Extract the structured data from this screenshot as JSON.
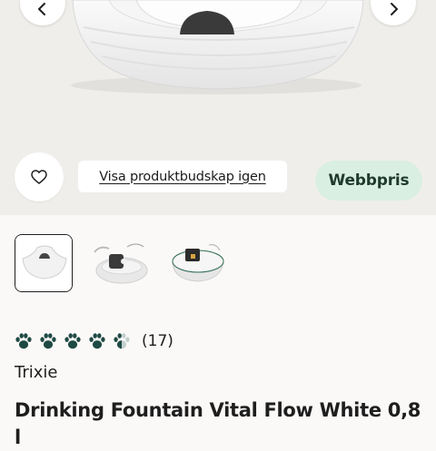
{
  "hero": {
    "prev_icon": "chevron-left-icon",
    "next_icon": "chevron-right-icon"
  },
  "actions": {
    "favorite_icon": "heart-icon",
    "show_message_label": "Visa produktbudskap igen",
    "price_badge_label": "Webbpris"
  },
  "gallery": {
    "thumbnails": [
      {
        "alt": "fountain-front",
        "selected": true
      },
      {
        "alt": "fountain-pump",
        "selected": false
      },
      {
        "alt": "fountain-top",
        "selected": false
      }
    ]
  },
  "rating": {
    "value": 4.5,
    "max": 5,
    "count_label": "(17)",
    "icon": "paw-icon"
  },
  "product": {
    "brand": "Trixie",
    "title": "Drinking Fountain Vital Flow White 0,8 l"
  },
  "colors": {
    "accent_dark": "#1f4a44",
    "badge_bg": "#d9efe1",
    "hero_bg": "#f0eeeb"
  }
}
